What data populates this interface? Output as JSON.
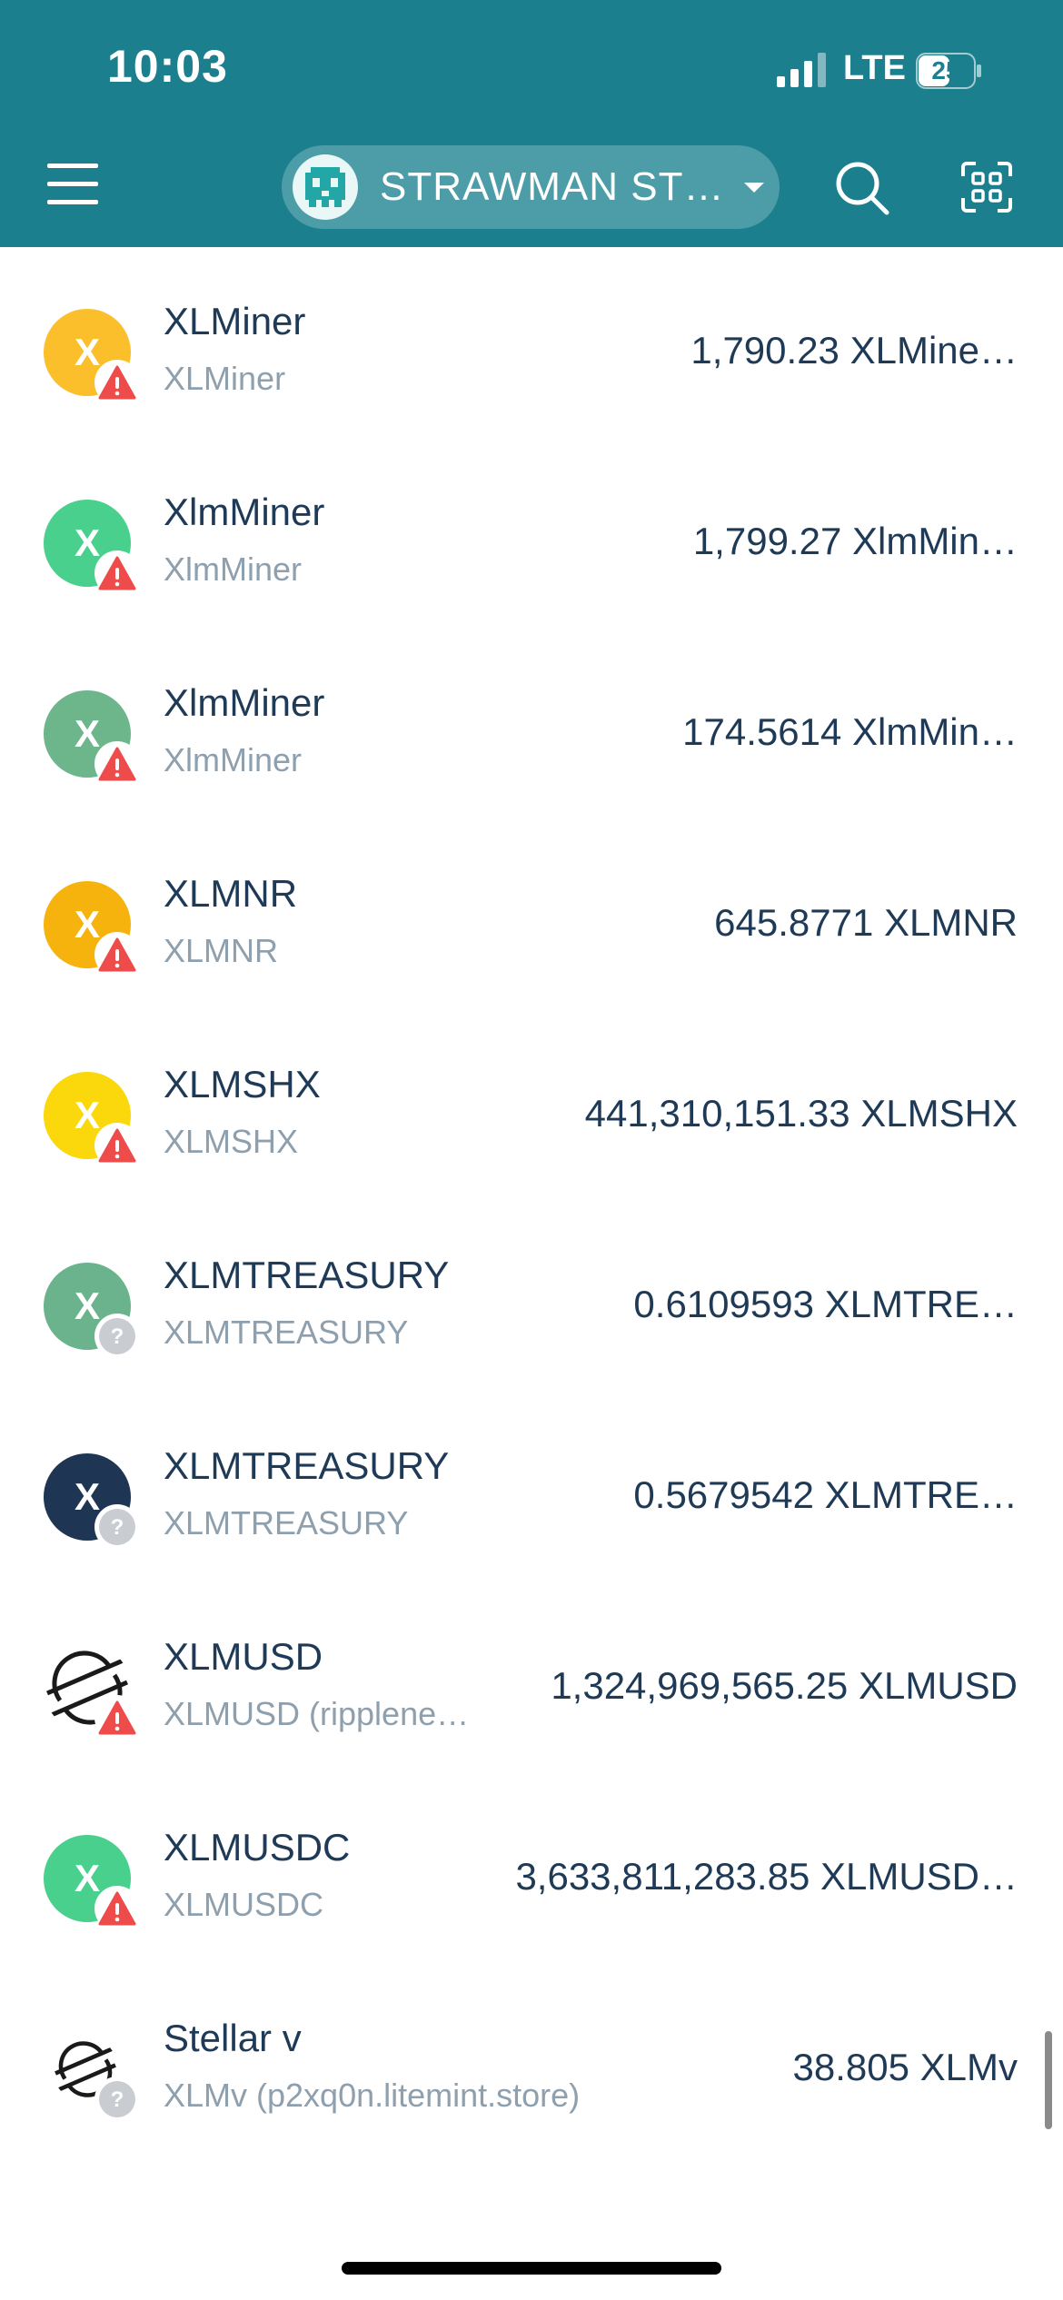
{
  "status_bar": {
    "time": "10:03",
    "network": "LTE",
    "battery": "25"
  },
  "header": {
    "account_name": "STRAWMAN ST…",
    "menu_icon": "hamburger-menu-icon",
    "search_icon": "search-icon",
    "scan_icon": "qr-scan-icon",
    "colors": {
      "background": "#1b7f8e",
      "pill": "#4c9da8"
    }
  },
  "assets": [
    {
      "letter": "X",
      "code": "XLMiner",
      "issuer": "XLMiner",
      "balance": "1,790.23 XLMine…",
      "icon_color": "#fbbf2c",
      "badge": "warning"
    },
    {
      "letter": "X",
      "code": "XlmMiner",
      "issuer": "XlmMiner",
      "balance": "1,799.27 XlmMin…",
      "icon_color": "#48d08c",
      "badge": "warning"
    },
    {
      "letter": "X",
      "code": "XlmMiner",
      "issuer": "XlmMiner",
      "balance": "174.5614 XlmMin…",
      "icon_color": "#6db58b",
      "badge": "warning"
    },
    {
      "letter": "X",
      "code": "XLMNR",
      "issuer": "XLMNR",
      "balance": "645.8771 XLMNR",
      "icon_color": "#f7b30d",
      "badge": "warning"
    },
    {
      "letter": "X",
      "code": "XLMSHX",
      "issuer": "XLMSHX",
      "balance": "441,310,151.33 XLMSHX",
      "icon_color": "#fbd80b",
      "badge": "warning"
    },
    {
      "letter": "X",
      "code": "XLMTREASURY",
      "issuer": "XLMTREASURY",
      "balance": "0.6109593 XLMTRE…",
      "icon_color": "#6bb38c",
      "badge": "unknown"
    },
    {
      "letter": "X",
      "code": "XLMTREASURY",
      "issuer": "XLMTREASURY",
      "balance": "0.5679542 XLMTRE…",
      "icon_color": "#1e3553",
      "badge": "unknown"
    },
    {
      "letter": "",
      "code": "XLMUSD",
      "issuer": "XLMUSD (ripplene…",
      "balance": "1,324,969,565.25 XLMUSD",
      "icon_color": "stellar-logo",
      "badge": "warning"
    },
    {
      "letter": "X",
      "code": "XLMUSDC",
      "issuer": "XLMUSDC",
      "balance": "3,633,811,283.85 XLMUSD…",
      "icon_color": "#48d08c",
      "badge": "warning"
    },
    {
      "letter": "",
      "code": "Stellar v",
      "issuer": "XLMv (p2xq0n.litemint.store)",
      "balance": "38.805 XLMv",
      "icon_color": "stellar-logo",
      "badge": "unknown"
    }
  ],
  "colors": {
    "text_primary": "#1e3a56",
    "text_secondary": "#8e9fae",
    "warning_red": "#ee4b4b",
    "unknown_gray": "#c9cdd2"
  }
}
